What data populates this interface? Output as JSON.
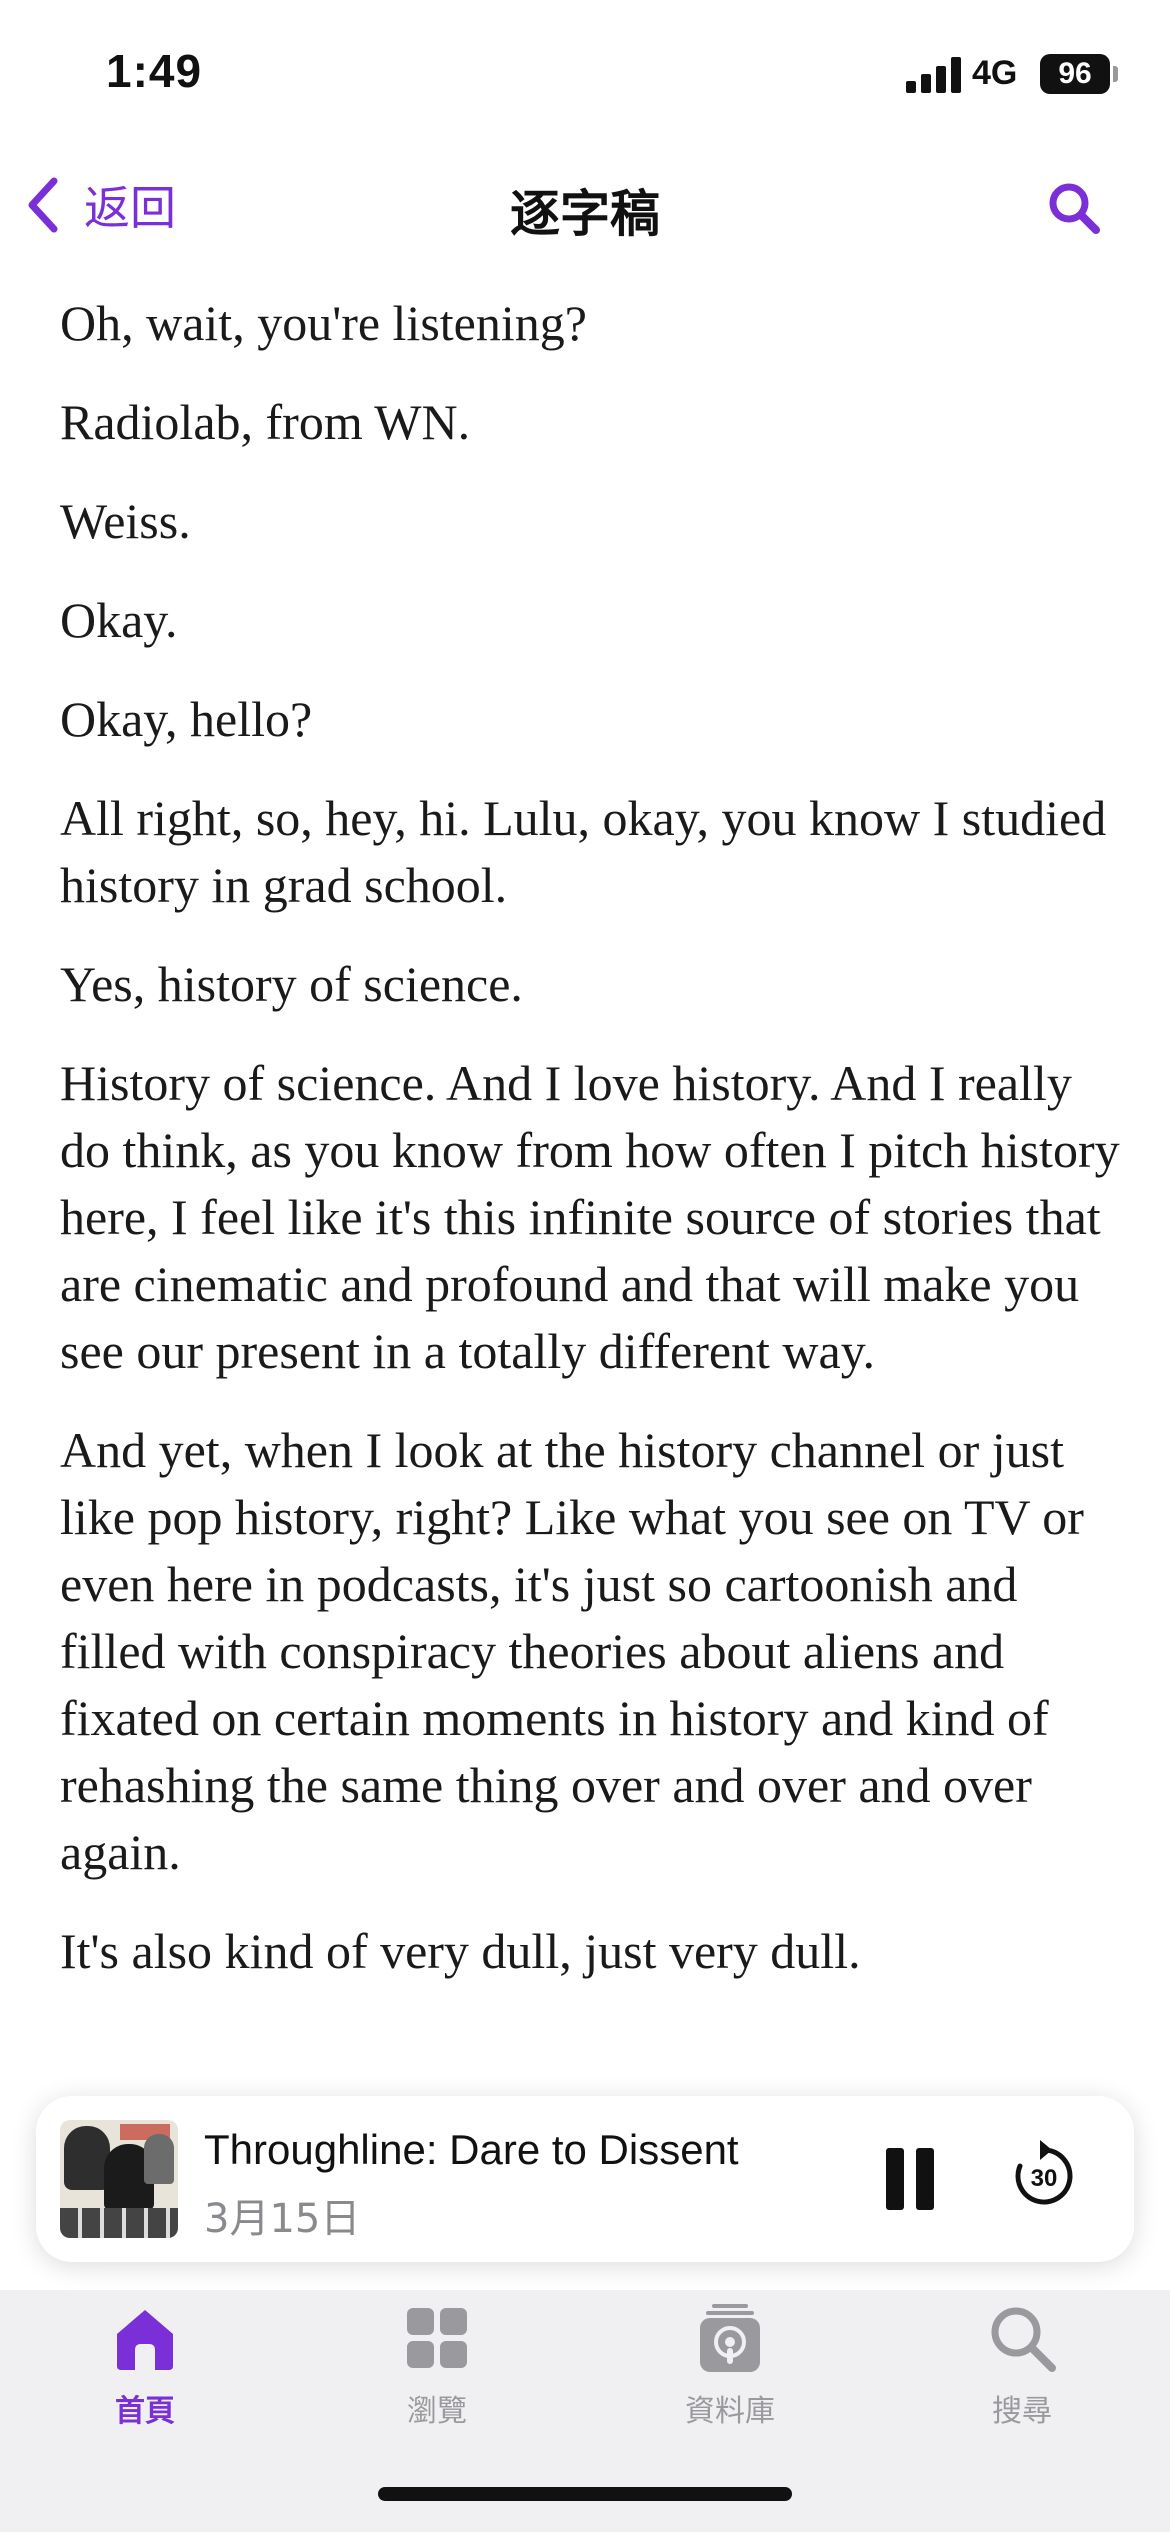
{
  "status_bar": {
    "time": "1:49",
    "network": "4G",
    "battery": "96"
  },
  "nav": {
    "back_label": "返回",
    "title": "逐字稿",
    "search_icon": "search-icon"
  },
  "transcript": {
    "paragraphs": [
      "Oh, wait, you're listening?",
      "Radiolab, from WN.",
      "Weiss.",
      "Okay.",
      "Okay, hello?",
      "All right, so, hey, hi. Lulu, okay, you know I studied history in grad school.",
      "Yes, history of science.",
      "History of science. And I love history. And I really do think, as you know from how often I pitch history here, I feel like it's this infinite source of stories that are cinematic and profound and that will make you see our present in a totally different way.",
      "And yet, when I look at the history channel or just like pop history, right? Like what you see on TV or even here in podcasts, it's just so cartoonish and filled with conspiracy theories about aliens and fixated on certain moments in history and kind of rehashing the same thing over and over and over again.",
      "It's also kind of very dull, just very dull."
    ]
  },
  "player": {
    "title": "Throughline: Dare to Dissent",
    "date": "3月15日",
    "skip_label": "30",
    "pause_icon": "pause-icon",
    "skip_icon": "skip-forward-30-icon"
  },
  "tabs": [
    {
      "label": "首頁",
      "icon": "home-icon",
      "active": true
    },
    {
      "label": "瀏覽",
      "icon": "browse-grid-icon",
      "active": false
    },
    {
      "label": "資料庫",
      "icon": "library-podcast-icon",
      "active": false
    },
    {
      "label": "搜尋",
      "icon": "search-icon",
      "active": false
    }
  ],
  "colors": {
    "accent": "#7b2fd6",
    "tab_inactive": "#9a9a9e",
    "tabbar_bg": "#f0f0f2"
  }
}
